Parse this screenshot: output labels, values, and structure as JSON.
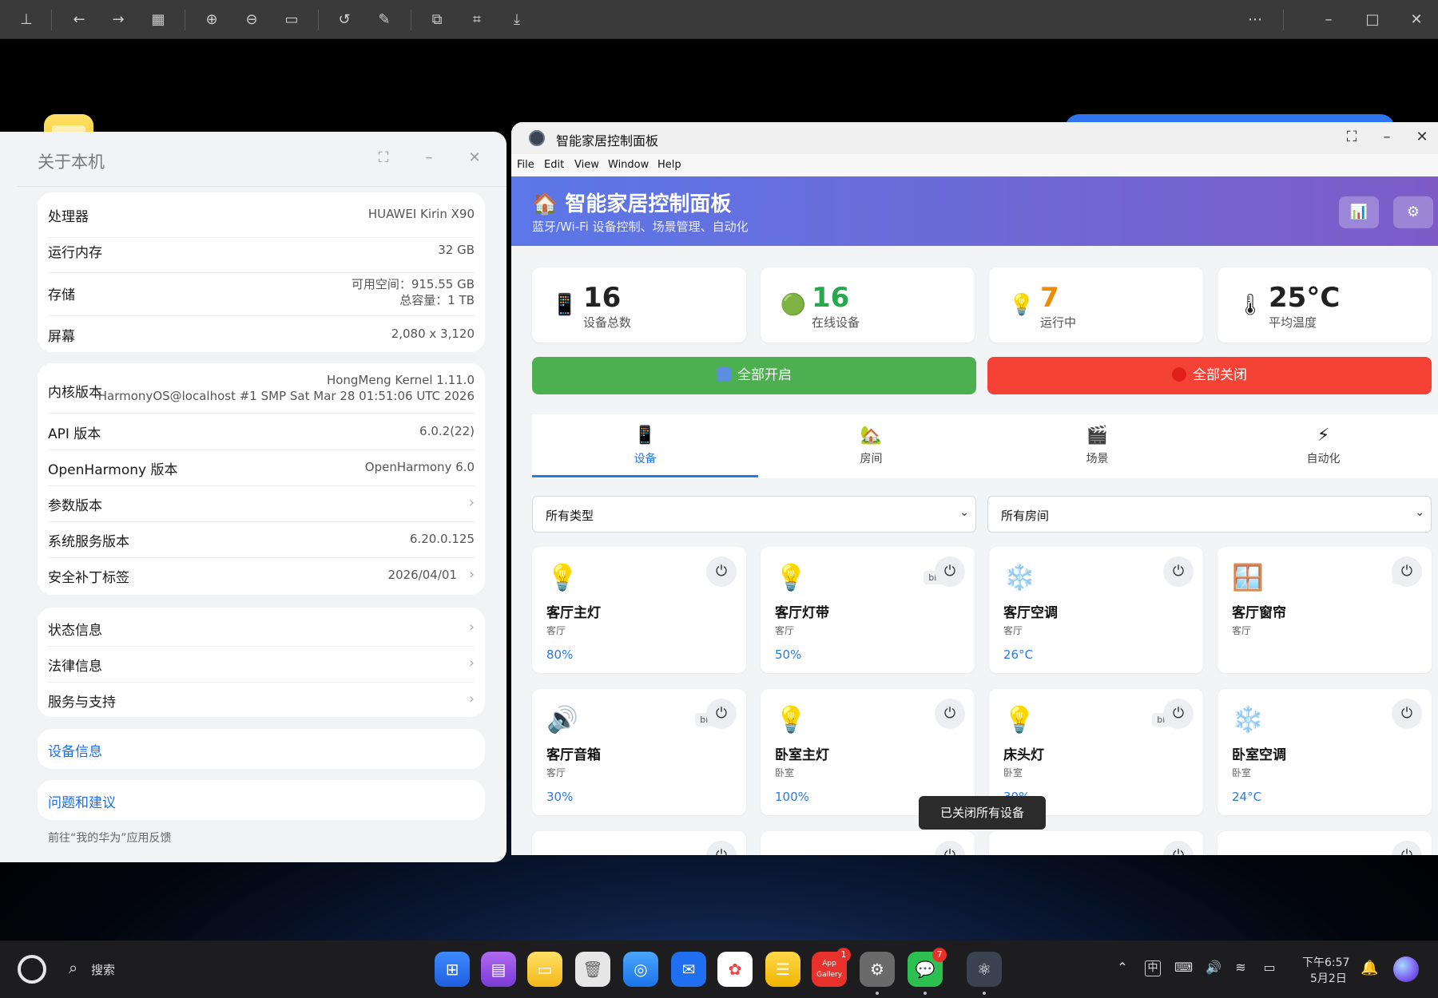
{
  "about": {
    "title": "关于本机",
    "card1": [
      {
        "label": "处理器",
        "value": "HUAWEI Kirin X90"
      },
      {
        "label": "运行内存",
        "value": "32 GB"
      },
      {
        "label": "存储",
        "value_line1": "可用空间：915.55 GB",
        "value_line2": "总容量：1 TB"
      },
      {
        "label": "屏幕",
        "value": "2,080 x 3,120"
      }
    ],
    "card2": [
      {
        "label": "内核版本",
        "value_line1": "HongMeng Kernel 1.11.0",
        "value_line2": "HarmonyOS@localhost #1 SMP Sat Mar 28 01:51:06 UTC 2026"
      },
      {
        "label": "API 版本",
        "value": "6.0.2(22)"
      },
      {
        "label": "OpenHarmony 版本",
        "value": "OpenHarmony 6.0"
      },
      {
        "label": "参数版本",
        "value": ""
      },
      {
        "label": "系统服务版本",
        "value": "6.20.0.125"
      },
      {
        "label": "安全补丁标签",
        "value": "2026/04/01"
      }
    ],
    "card3": [
      {
        "label": "状态信息"
      },
      {
        "label": "法律信息"
      },
      {
        "label": "服务与支持"
      }
    ],
    "device_info": "设备信息",
    "feedback": "问题和建议",
    "feedback_hint": "前往“我的华为”应用反馈"
  },
  "smarthome": {
    "window_title": "智能家居控制面板",
    "menu": [
      "File",
      "Edit",
      "View",
      "Window",
      "Help"
    ],
    "header_title": "🏠 智能家居控制面板",
    "header_subtitle": "蓝牙/Wi-Fi 设备控制、场景管理、自动化",
    "stats": [
      {
        "icon": "📱",
        "value": "16",
        "label": "设备总数",
        "color": "#222222"
      },
      {
        "icon": "🟢",
        "value": "16",
        "label": "在线设备",
        "color": "#27a84a"
      },
      {
        "icon": "💡",
        "value": "7",
        "label": "运行中",
        "color": "#f08c00"
      },
      {
        "icon": "🌡",
        "value": "25°C",
        "label": "平均温度",
        "color": "#222222"
      }
    ],
    "all_on": "全部开启",
    "all_off": "全部关闭",
    "colors": {
      "all_on": "#4caf50",
      "all_off": "#f44336",
      "accent": "#2a7ae4"
    },
    "tabs": [
      {
        "icon": "📱",
        "label": "设备"
      },
      {
        "icon": "🏡",
        "label": "房间"
      },
      {
        "icon": "🎬",
        "label": "场景"
      },
      {
        "icon": "⚡",
        "label": "自动化"
      }
    ],
    "filter_type": "所有类型",
    "filter_room": "所有房间",
    "devices": [
      {
        "icon": "💡",
        "name": "客厅主灯",
        "room": "客厅",
        "value": "80%",
        "tag": ""
      },
      {
        "icon": "💡",
        "name": "客厅灯带",
        "room": "客厅",
        "value": "50%",
        "tag": "blue"
      },
      {
        "icon": "❄️",
        "name": "客厅空调",
        "room": "客厅",
        "value": "26°C",
        "tag": ""
      },
      {
        "icon": "🪟",
        "name": "客厅窗帘",
        "room": "客厅",
        "value": "",
        "tag": "zi"
      },
      {
        "icon": "🔊",
        "name": "客厅音箱",
        "room": "客厅",
        "value": "30%",
        "tag": "blue"
      },
      {
        "icon": "💡",
        "name": "卧室主灯",
        "room": "卧室",
        "value": "100%",
        "tag": ""
      },
      {
        "icon": "💡",
        "name": "床头灯",
        "room": "卧室",
        "value": "30%",
        "tag": "blue"
      },
      {
        "icon": "❄️",
        "name": "卧室空调",
        "room": "卧室",
        "value": "24°C",
        "tag": ""
      }
    ],
    "toast": "已关闭所有设备"
  },
  "taskbar": {
    "search": "搜索",
    "badges": {
      "appgallery": "1",
      "wechat": "7"
    },
    "appgallery_label": "App Gallery",
    "time": "下午6:57",
    "date": "5月2日",
    "ime": "中"
  }
}
